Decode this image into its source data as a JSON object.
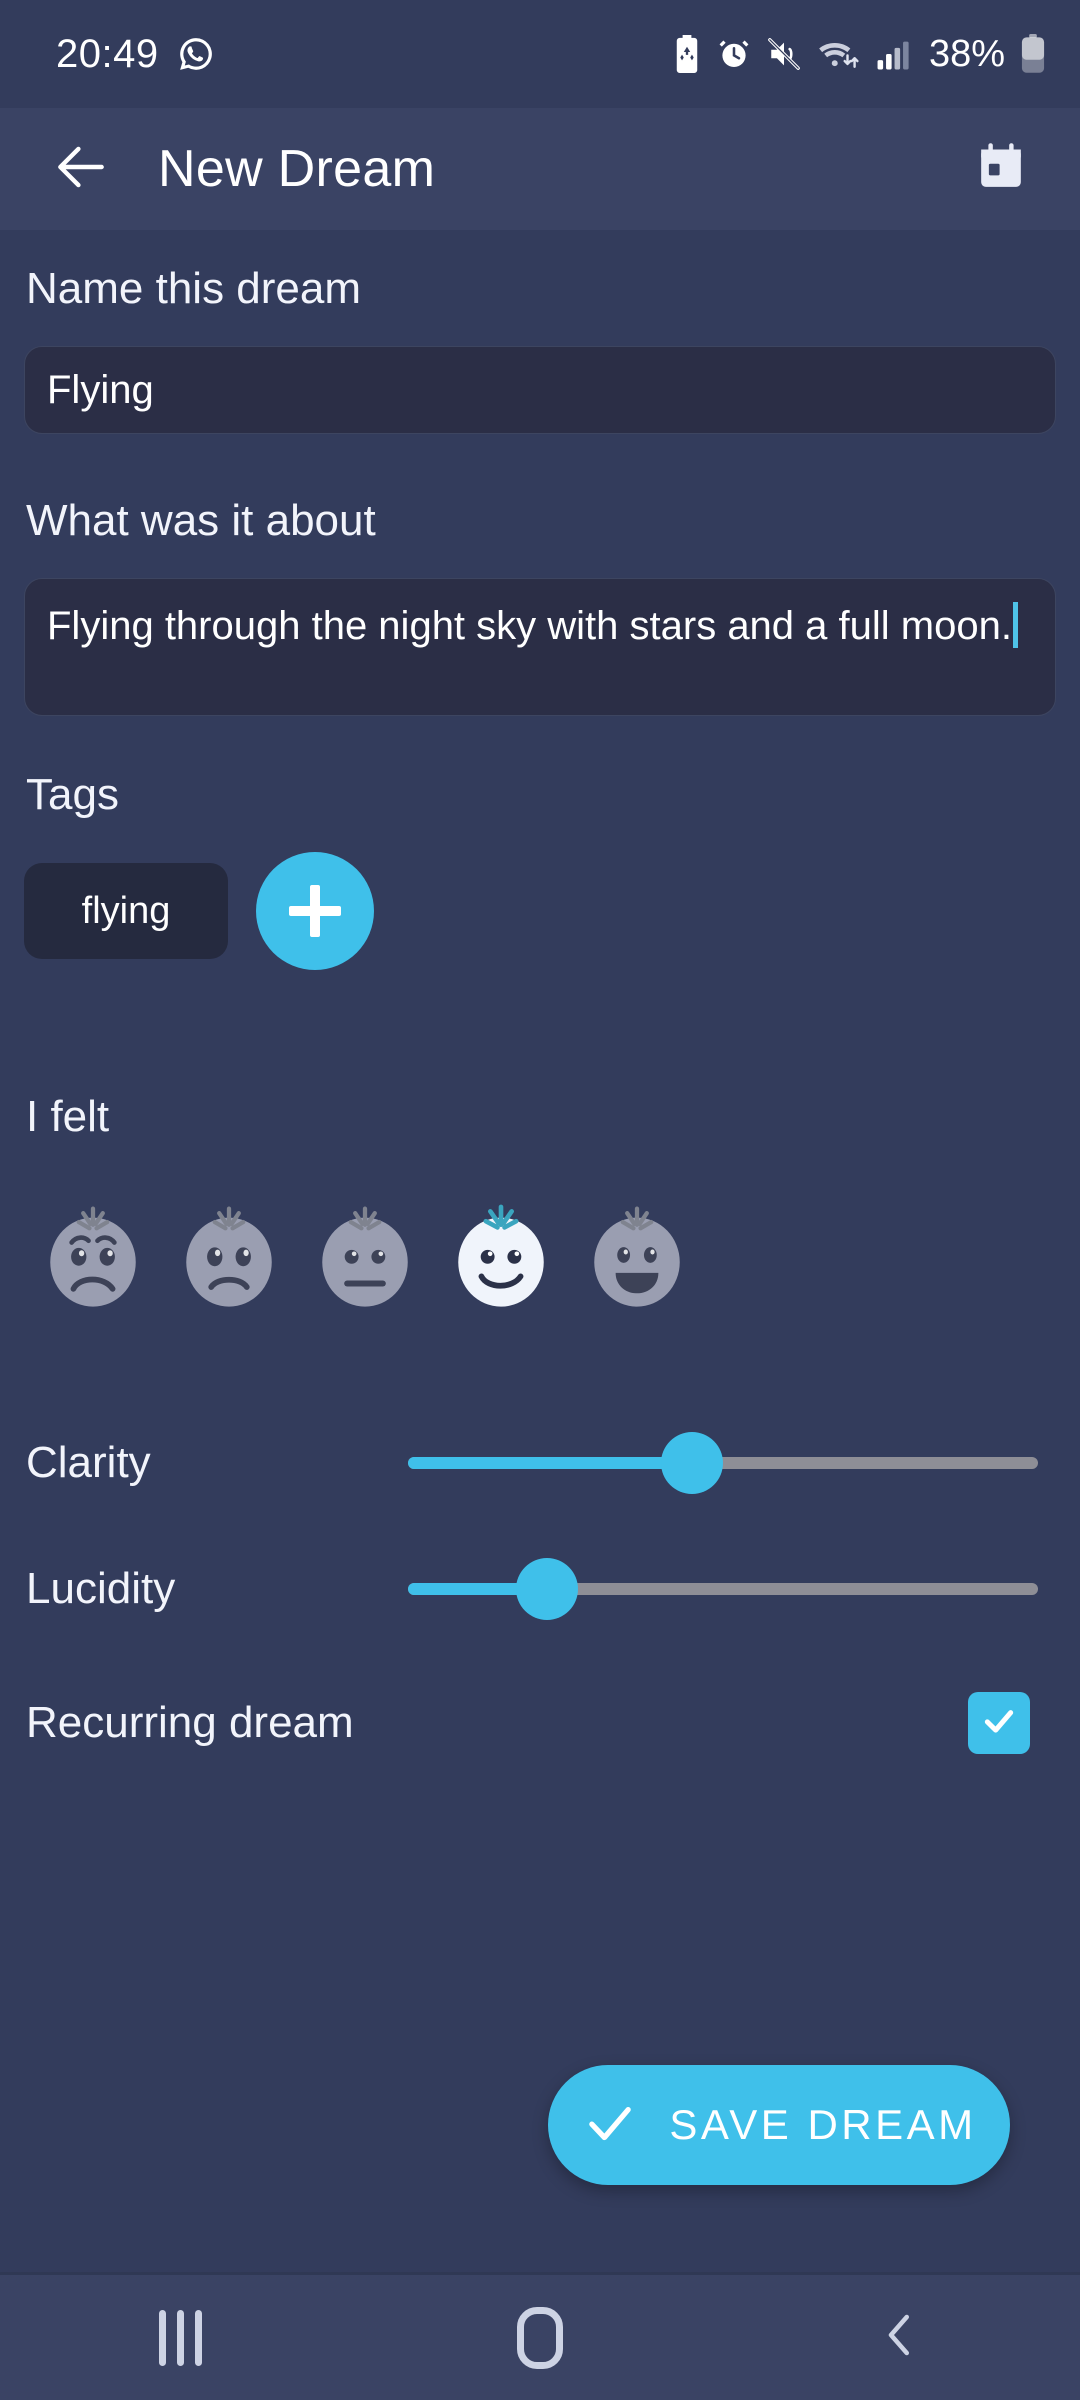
{
  "status_bar": {
    "clock": "20:49",
    "battery_percent": "38%",
    "icons_left": [
      "whatsapp-icon"
    ],
    "icons_right": [
      "battery-saver-icon",
      "alarm-icon",
      "volume-off-icon",
      "wifi-icon",
      "signal-icon",
      "battery-icon"
    ]
  },
  "app_bar": {
    "title": "New Dream",
    "back_icon": "arrow-back-icon",
    "calendar_icon": "calendar-icon"
  },
  "form": {
    "name": {
      "label": "Name this dream",
      "value": "Flying",
      "placeholder": "Name this dream"
    },
    "about": {
      "label": "What was it about",
      "value": "Flying through the night sky with stars and a full moon.",
      "placeholder": "What was it about"
    },
    "tags": {
      "label": "Tags",
      "chips": [
        "flying"
      ],
      "add_button_icon": "plus-icon"
    },
    "mood": {
      "label": "I felt",
      "options": [
        "very-sad",
        "sad",
        "neutral",
        "happy",
        "very-happy"
      ],
      "selected_index": 3
    },
    "clarity": {
      "label": "Clarity",
      "value": 45,
      "min": 0,
      "max": 100
    },
    "lucidity": {
      "label": "Lucidity",
      "value": 22,
      "min": 0,
      "max": 100
    },
    "recurring": {
      "label": "Recurring dream",
      "checked": true
    }
  },
  "save_button": {
    "label": "SAVE DREAM",
    "icon": "check-icon"
  },
  "nav_bar": {
    "recents_label": "recents-icon",
    "home_label": "home-icon",
    "back_label": "back-icon"
  },
  "colors": {
    "background": "#333c5c",
    "app_bar": "#3a4364",
    "field_fill": "#2b2e46",
    "chip_fill": "#252a3f",
    "accent": "#3fc0ea",
    "text": "#f2f4fb",
    "slider_track": "#8e8e96"
  }
}
